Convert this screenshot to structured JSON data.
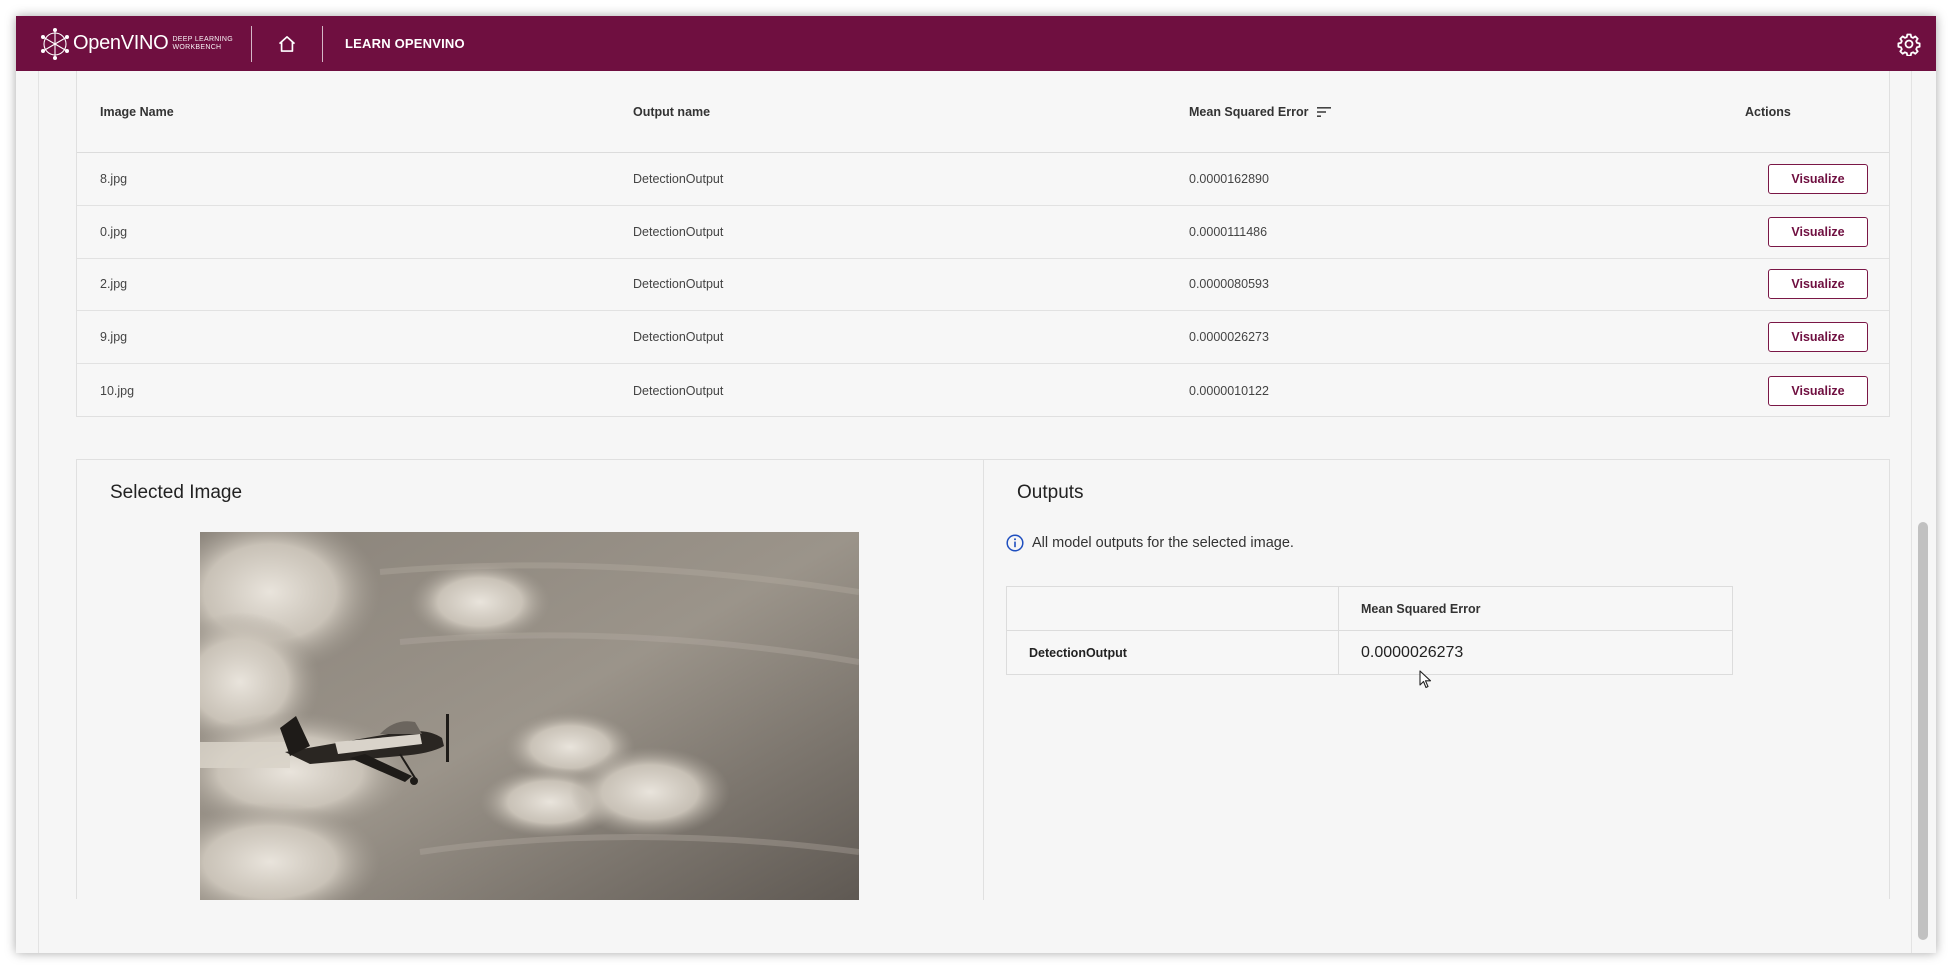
{
  "header": {
    "logo_text": "OpenVINO",
    "logo_sub_1": "DEEP LEARNING",
    "logo_sub_2": "WORKBENCH",
    "learn_link": "LEARN OPENVINO",
    "home_icon": "home-icon",
    "settings_icon": "gear-icon"
  },
  "results_table": {
    "columns": [
      "Image Name",
      "Output name",
      "Mean Squared Error",
      "Actions"
    ],
    "sort_icon": "sort-icon",
    "rows": [
      {
        "image": "8.jpg",
        "output": "DetectionOutput",
        "mse": "0.0000162890",
        "action": "Visualize"
      },
      {
        "image": "0.jpg",
        "output": "DetectionOutput",
        "mse": "0.0000111486",
        "action": "Visualize"
      },
      {
        "image": "2.jpg",
        "output": "DetectionOutput",
        "mse": "0.0000080593",
        "action": "Visualize"
      },
      {
        "image": "9.jpg",
        "output": "DetectionOutput",
        "mse": "0.0000026273",
        "action": "Visualize"
      },
      {
        "image": "10.jpg",
        "output": "DetectionOutput",
        "mse": "0.0000010122",
        "action": "Visualize"
      }
    ]
  },
  "selected_image": {
    "title": "Selected Image"
  },
  "outputs": {
    "title": "Outputs",
    "info_text": "All model outputs for the selected image.",
    "info_icon": "info-icon",
    "table_header_empty": "",
    "table_header": "Mean Squared Error",
    "rows": [
      {
        "name": "DetectionOutput",
        "mse": "0.0000026273"
      }
    ]
  },
  "colors": {
    "brand": "#6f0f40",
    "background": "#f6f6f6"
  }
}
